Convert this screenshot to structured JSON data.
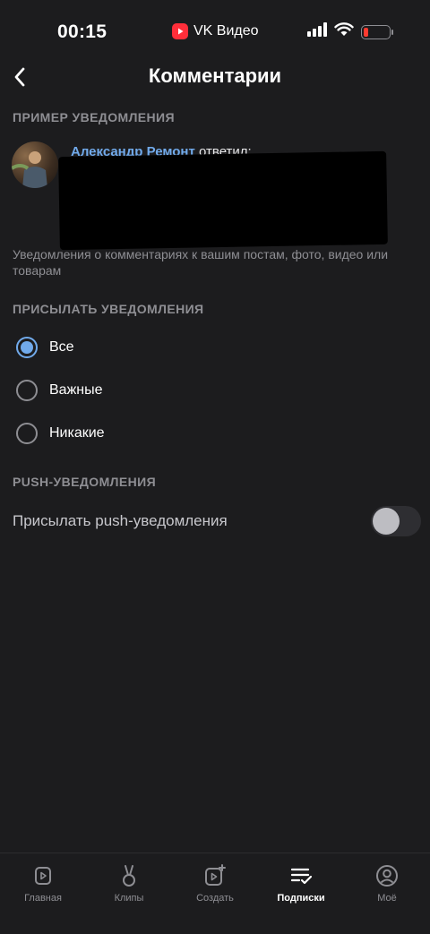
{
  "status_bar": {
    "time": "00:15",
    "app_name": "VK Видео"
  },
  "header": {
    "title": "Комментарии"
  },
  "example_section": {
    "header": "Пример уведомления",
    "author": "Александр Ремонт",
    "action": "ответил:",
    "description": "Уведомления о комментариях к вашим постам, фото, видео или товарам"
  },
  "send_section": {
    "header": "Присылать уведомления",
    "options": [
      {
        "label": "Все",
        "checked": true
      },
      {
        "label": "Важные",
        "checked": false
      },
      {
        "label": "Никакие",
        "checked": false
      }
    ]
  },
  "push_section": {
    "header": "Push-уведомления",
    "toggle_label": "Присылать push-уведомления",
    "toggle_on": false
  },
  "tab_bar": {
    "tabs": [
      {
        "label": "Главная",
        "icon": "play-square-icon",
        "active": false
      },
      {
        "label": "Клипы",
        "icon": "clips-icon",
        "active": false
      },
      {
        "label": "Создать",
        "icon": "create-video-icon",
        "active": false
      },
      {
        "label": "Подписки",
        "icon": "subscriptions-icon",
        "active": true
      },
      {
        "label": "Моё",
        "icon": "profile-icon",
        "active": false
      }
    ]
  },
  "colors": {
    "background": "#1c1c1e",
    "accent": "#71aaeb",
    "muted": "#8e8e93",
    "battery_low": "#ff3b30",
    "vk_video_brand": "#ff2e3a"
  }
}
